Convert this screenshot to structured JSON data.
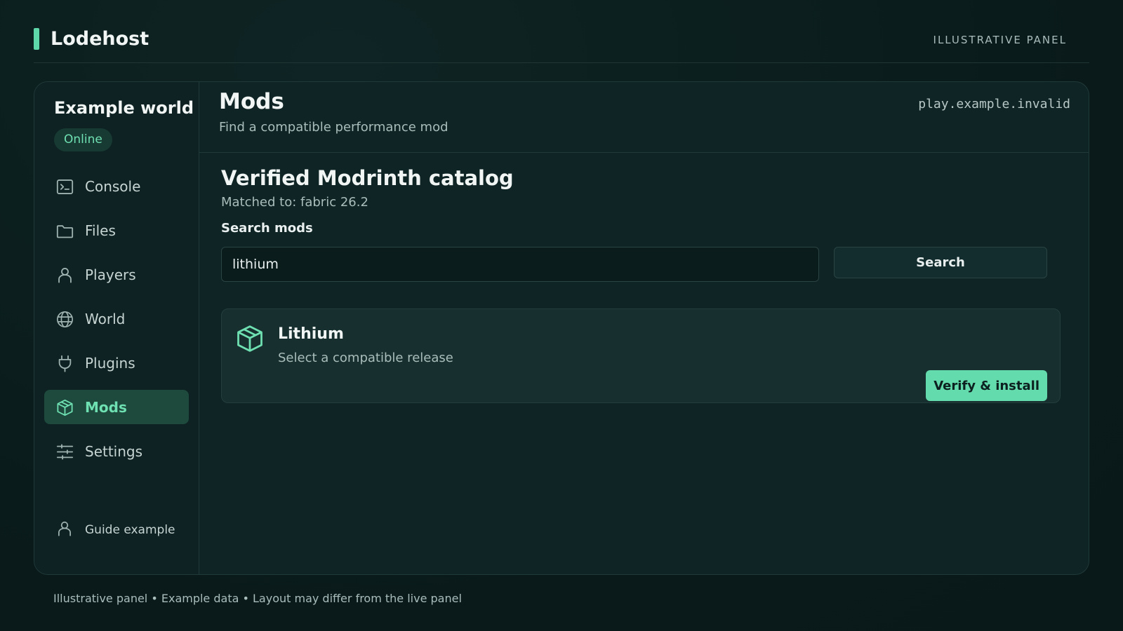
{
  "header": {
    "brand": "Lodehost",
    "panel_tag": "ILLUSTRATIVE PANEL"
  },
  "sidebar": {
    "world_name": "Example world",
    "status": "Online",
    "items": [
      {
        "label": "Console",
        "icon": "terminal-icon"
      },
      {
        "label": "Files",
        "icon": "folder-icon"
      },
      {
        "label": "Players",
        "icon": "user-icon"
      },
      {
        "label": "World",
        "icon": "globe-icon"
      },
      {
        "label": "Plugins",
        "icon": "plug-icon"
      },
      {
        "label": "Mods",
        "icon": "package-icon",
        "active": true
      },
      {
        "label": "Settings",
        "icon": "sliders-icon"
      }
    ],
    "guide_label": "Guide example"
  },
  "main": {
    "title": "Mods",
    "subtitle": "Find a compatible performance mod",
    "host": "play.example.invalid",
    "catalog_title": "Verified Modrinth catalog",
    "catalog_sub": "Matched to: fabric 26.2",
    "search_label": "Search mods",
    "search_value": "lithium",
    "search_button": "Search",
    "result": {
      "name": "Lithium",
      "sub": "Select a compatible release",
      "install_button": "Verify & install"
    }
  },
  "footer": {
    "note": "Illustrative panel • Example data • Layout may differ from the live panel"
  },
  "colors": {
    "accent": "#5ed8a8",
    "background": "#0a1b1b",
    "active_nav": "#1d4a3d"
  }
}
